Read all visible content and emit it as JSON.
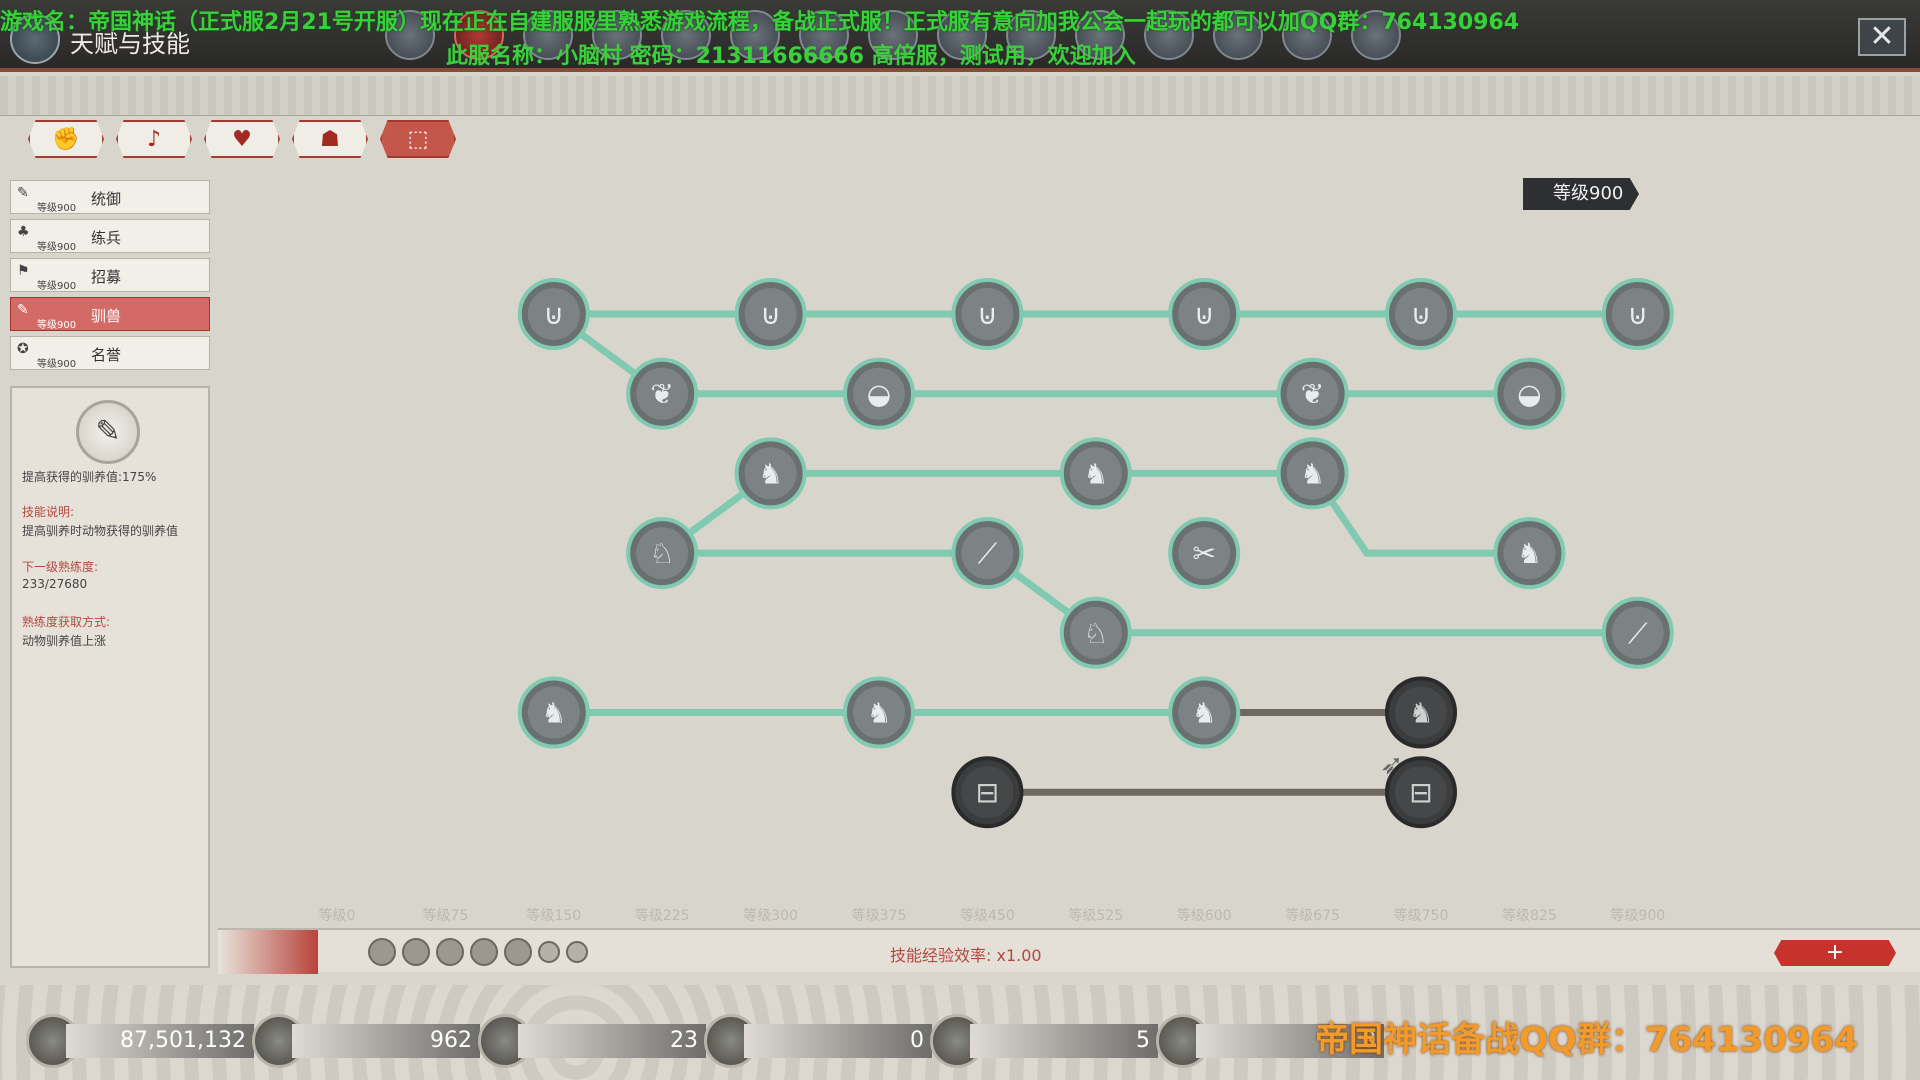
{
  "header": {
    "title": "天赋与技能",
    "ticker_line1": "游戏名：帝国神话（正式服2月21号开服）现在正在自建服服里熟悉游戏流程，备战正式服！正式服有意向加我公会一起玩的都可以加QQ群：764130964",
    "ticker_line2": "此服名称：小脑村 密码：21311666666 高倍服，测试用，欢迎加入",
    "close_label": "✕"
  },
  "category_tabs": [
    {
      "icon": "✊",
      "active": false
    },
    {
      "icon": "♪",
      "active": false
    },
    {
      "icon": "♥",
      "active": false
    },
    {
      "icon": "☗",
      "active": false
    },
    {
      "icon": "⬚",
      "active": true
    }
  ],
  "nav": [
    {
      "label": "统御",
      "level": "等级900",
      "icon": "✎",
      "active": false
    },
    {
      "label": "练兵",
      "level": "等级900",
      "icon": "♣",
      "active": false
    },
    {
      "label": "招募",
      "level": "等级900",
      "icon": "⚑",
      "active": false
    },
    {
      "label": "驯兽",
      "level": "等级900",
      "icon": "✎",
      "active": true
    },
    {
      "label": "名誉",
      "level": "等级900",
      "icon": "✪",
      "active": false
    }
  ],
  "detail": {
    "effect": "提高获得的驯养值:175%",
    "skill_desc_label": "技能说明:",
    "skill_desc": "提高驯养时动物获得的驯养值",
    "next_level_label": "下一级熟练度:",
    "next_level_value": "233/27680",
    "gain_method_label": "熟练度获取方式:",
    "gain_method": "动物驯养值上涨"
  },
  "level_badge": "等级900",
  "axis": {
    "labels": [
      "等级0",
      "等级75",
      "等级150",
      "等级225",
      "等级300",
      "等级375",
      "等级450",
      "等级525",
      "等级600",
      "等级675",
      "等级750",
      "等级825",
      "等级900"
    ]
  },
  "bottom": {
    "efficiency": "技能经验效率: x1.00",
    "plus_label": "+"
  },
  "resources": [
    {
      "name": "silver-coins",
      "value": "87,501,132"
    },
    {
      "name": "crystal",
      "value": "962"
    },
    {
      "name": "gold-coin",
      "value": "23"
    },
    {
      "name": "gems",
      "value": "0"
    },
    {
      "name": "refresh-token",
      "value": "5"
    },
    {
      "name": "chest",
      "value": "0"
    }
  ],
  "qq_ad": "帝国神话备战QQ群：764130964",
  "tree": {
    "columns": [
      "等级0",
      "等级75",
      "等级150",
      "等级225",
      "等级300",
      "等级375",
      "等级450",
      "等级525",
      "等级600",
      "等级675",
      "等级750",
      "等级825",
      "等级900"
    ],
    "nodes": [
      {
        "id": "r1c150",
        "row": 1,
        "col": "等级150",
        "icon": "saddle-icon",
        "unlocked": true
      },
      {
        "id": "r1c300",
        "row": 1,
        "col": "等级300",
        "icon": "saddle-icon",
        "unlocked": true
      },
      {
        "id": "r1c450",
        "row": 1,
        "col": "等级450",
        "icon": "saddle-icon",
        "unlocked": true
      },
      {
        "id": "r1c600",
        "row": 1,
        "col": "等级600",
        "icon": "saddle-icon",
        "unlocked": true
      },
      {
        "id": "r1c750",
        "row": 1,
        "col": "等级750",
        "icon": "saddle-icon",
        "unlocked": true
      },
      {
        "id": "r1c900",
        "row": 1,
        "col": "等级900",
        "icon": "saddle-icon",
        "unlocked": true
      },
      {
        "id": "r2c225",
        "row": 2,
        "col": "等级225",
        "icon": "grass-icon",
        "unlocked": true
      },
      {
        "id": "r2c375",
        "row": 2,
        "col": "等级375",
        "icon": "feed-trough-icon",
        "unlocked": true
      },
      {
        "id": "r2c675",
        "row": 2,
        "col": "等级675",
        "icon": "grass-icon",
        "unlocked": true
      },
      {
        "id": "r2c825",
        "row": 2,
        "col": "等级825",
        "icon": "feed-trough-icon",
        "unlocked": true
      },
      {
        "id": "r3c300",
        "row": 3,
        "col": "等级300",
        "icon": "horse-head-icon",
        "unlocked": true
      },
      {
        "id": "r3c525",
        "row": 3,
        "col": "等级525",
        "icon": "horse-head-icon",
        "unlocked": true
      },
      {
        "id": "r3c675",
        "row": 3,
        "col": "等级675",
        "icon": "horse-head-icon",
        "unlocked": true
      },
      {
        "id": "r4c225",
        "row": 4,
        "col": "等级225",
        "icon": "rider-icon",
        "unlocked": true
      },
      {
        "id": "r4c450",
        "row": 4,
        "col": "等级450",
        "icon": "whip-icon",
        "unlocked": true
      },
      {
        "id": "r4c600",
        "row": 4,
        "col": "等级600",
        "icon": "grooming-icon",
        "unlocked": true
      },
      {
        "id": "r4c825",
        "row": 4,
        "col": "等级825",
        "icon": "horse-head-icon",
        "unlocked": true
      },
      {
        "id": "r5c525",
        "row": 5,
        "col": "等级525",
        "icon": "rider-icon",
        "unlocked": true
      },
      {
        "id": "r5c900",
        "row": 5,
        "col": "等级900",
        "icon": "whip-icon",
        "unlocked": true
      },
      {
        "id": "r6c150",
        "row": 6,
        "col": "等级150",
        "icon": "galloping-horse-icon",
        "unlocked": true
      },
      {
        "id": "r6c375",
        "row": 6,
        "col": "等级375",
        "icon": "galloping-horse-icon",
        "unlocked": true
      },
      {
        "id": "r6c600",
        "row": 6,
        "col": "等级600",
        "icon": "galloping-horse-icon",
        "unlocked": true
      },
      {
        "id": "r6c750",
        "row": 6,
        "col": "等级750",
        "icon": "galloping-horse-icon",
        "unlocked": false
      },
      {
        "id": "r7c450",
        "row": 7,
        "col": "等级450",
        "icon": "saddlebag-icon",
        "unlocked": false
      },
      {
        "id": "r7c750",
        "row": 7,
        "col": "等级750",
        "icon": "saddlebag-icon",
        "unlocked": false
      }
    ],
    "links": [
      [
        "r1c150",
        "r1c300",
        true
      ],
      [
        "r1c300",
        "r1c450",
        true
      ],
      [
        "r1c450",
        "r1c600",
        true
      ],
      [
        "r1c600",
        "r1c750",
        true
      ],
      [
        "r1c750",
        "r1c900",
        true
      ],
      [
        "r1c150",
        "r2c225",
        true
      ],
      [
        "r2c225",
        "r2c375",
        true
      ],
      [
        "r2c375",
        "r2c675",
        true
      ],
      [
        "r2c675",
        "r2c825",
        true
      ],
      [
        "r4c225",
        "r3c300",
        true
      ],
      [
        "r3c300",
        "r3c525",
        true
      ],
      [
        "r3c525",
        "r3c675",
        true
      ],
      [
        "r3c675",
        "r4c825",
        true
      ],
      [
        "r4c225",
        "r4c450",
        true
      ],
      [
        "r4c450",
        "r5c525",
        true
      ],
      [
        "r5c525",
        "r5c900",
        true
      ],
      [
        "r6c150",
        "r6c375",
        true
      ],
      [
        "r6c375",
        "r6c600",
        true
      ],
      [
        "r6c600",
        "r6c750",
        false
      ],
      [
        "r7c450",
        "r7c750",
        false
      ]
    ],
    "colors": {
      "active_link": "#7fcab0",
      "locked_link": "#6e6a63",
      "node_ring": "#7fcab0",
      "node_fill": "#6a6f70",
      "locked_fill": "#3a3c3d"
    }
  }
}
